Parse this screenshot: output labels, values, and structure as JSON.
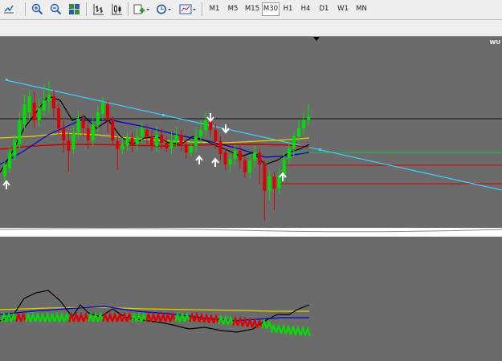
{
  "toolbar": {
    "timeframes": [
      "M1",
      "M5",
      "M15",
      "M30",
      "H1",
      "H4",
      "D1",
      "W1",
      "MN"
    ],
    "active_timeframe": "M30",
    "icons": [
      "zoom-in-icon",
      "zoom-out-icon",
      "tile-windows-icon",
      "bar-chart-icon",
      "candlestick-chart-icon",
      "add-indicator-icon",
      "clock-periodicity-icon",
      "template-icon"
    ]
  },
  "chart": {
    "symbol_label": "WU",
    "colors": {
      "background": "#6b6b6b",
      "bull_candle": "#00e000",
      "bear_candle": "#e00000",
      "trendline": "#40d0ff",
      "ma_fast": "#000000",
      "ma_medium": "#0000cc",
      "ma_slow": "#e0d000",
      "ma_red": "#cc0000",
      "arrows": "#ffffff"
    }
  }
}
